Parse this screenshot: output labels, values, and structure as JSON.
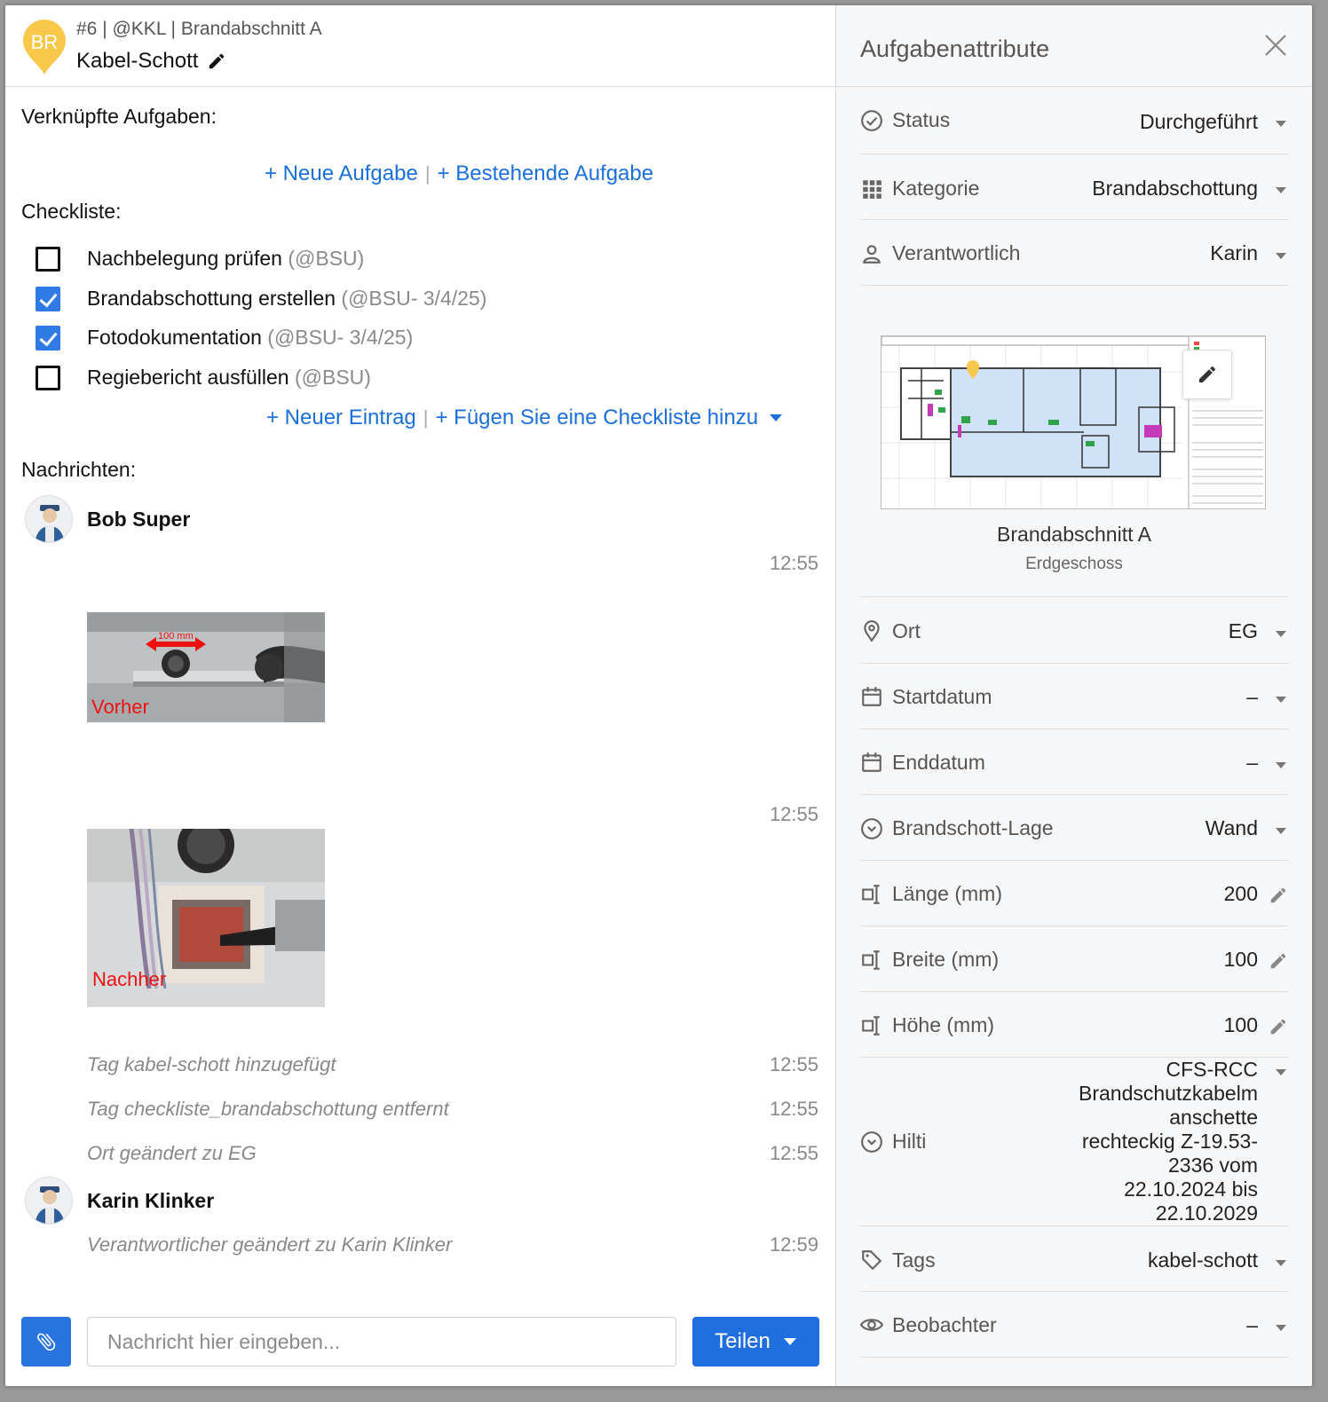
{
  "header": {
    "pin_label": "BR",
    "subtitle": "#6 | @KKL | Brandabschnitt A",
    "title": "Kabel-Schott"
  },
  "linked_tasks": {
    "label": "Verknüpfte Aufgaben:",
    "new_task": "+ Neue Aufgabe",
    "existing_task": "+ Bestehende Aufgabe"
  },
  "checklist": {
    "label": "Checkliste:",
    "items": [
      {
        "text": "Nachbelegung prüfen",
        "meta": "(@BSU)",
        "checked": false
      },
      {
        "text": "Brandabschottung erstellen",
        "meta": "(@BSU- 3/4/25)",
        "checked": true
      },
      {
        "text": "Fotodokumentation",
        "meta": "(@BSU- 3/4/25)",
        "checked": true
      },
      {
        "text": "Regiebericht ausfüllen",
        "meta": "(@BSU)",
        "checked": false
      }
    ],
    "new_entry": "+ Neuer Eintrag",
    "add_checklist": "+ Fügen Sie eine Checkliste hinzu"
  },
  "messages": {
    "label": "Nachrichten:",
    "user1": "Bob Super",
    "time1": "12:55",
    "photo1_caption": "Vorher",
    "photo1_measure": "100 mm",
    "time2": "12:55",
    "photo2_caption": "Nachher",
    "events": [
      {
        "text": "Tag kabel-schott hinzugefügt",
        "time": "12:55"
      },
      {
        "text": "Tag checkliste_brandabschottung entfernt",
        "time": "12:55"
      },
      {
        "text": "Ort geändert zu EG",
        "time": "12:55"
      }
    ],
    "user2": "Karin Klinker",
    "event_last": {
      "text": "Verantwortlicher geändert zu Karin Klinker",
      "time": "12:59"
    }
  },
  "composer": {
    "placeholder": "Nachricht hier eingeben...",
    "share": "Teilen"
  },
  "panel": {
    "title": "Aufgabenattribute",
    "status": {
      "label": "Status",
      "value": "Durchgeführt"
    },
    "category": {
      "label": "Kategorie",
      "value": "Brandabschottung"
    },
    "responsible": {
      "label": "Verantwortlich",
      "value": "Karin"
    },
    "plan": {
      "name": "Brandabschnitt A",
      "floor": "Erdgeschoss"
    },
    "location": {
      "label": "Ort",
      "value": "EG"
    },
    "start": {
      "label": "Startdatum",
      "value": "–"
    },
    "end": {
      "label": "Enddatum",
      "value": "–"
    },
    "position": {
      "label": "Brandschott-Lage",
      "value": "Wand"
    },
    "length": {
      "label": "Länge (mm)",
      "value": "200"
    },
    "width": {
      "label": "Breite (mm)",
      "value": "100"
    },
    "height": {
      "label": "Höhe (mm)",
      "value": "100"
    },
    "hilti": {
      "label": "Hilti",
      "lines": [
        "CFS-RCC",
        "Brandschutzkabelm",
        "anschette",
        "rechteckig Z-19.53-",
        "2336 vom",
        "22.10.2024 bis",
        "22.10.2029"
      ]
    },
    "tags": {
      "label": "Tags",
      "value": "kabel-schott"
    },
    "observers": {
      "label": "Beobachter",
      "value": "–"
    }
  },
  "colors": {
    "link": "#1a6fdc",
    "primary": "#1f6fe0",
    "pin": "#f8c84a",
    "check": "#2f7ae5"
  }
}
